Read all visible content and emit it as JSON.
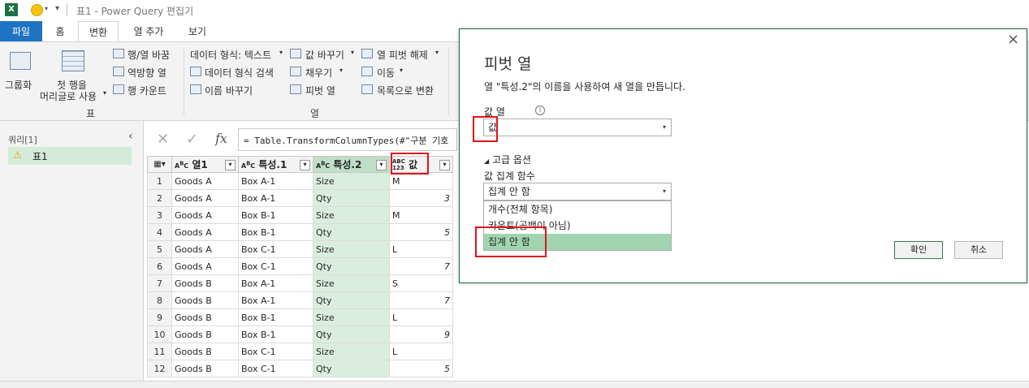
{
  "window": {
    "title": "표1 - Power Query 편집기",
    "app_icon": "excel-icon"
  },
  "ribbon": {
    "tabs": [
      "파일",
      "홈",
      "변환",
      "열 추가",
      "보기"
    ],
    "active_tab": "변환",
    "group_table": {
      "label": "표",
      "group_by": "그룹화",
      "first_row_line1": "첫 행을",
      "first_row_line2": "머리글로 사용",
      "transpose": "행/열 바꿈",
      "reverse_rows": "역방향 열",
      "count_rows": "행 카운트"
    },
    "group_column": {
      "label": "열",
      "data_type": "데이터 형식: 텍스트",
      "detect_type": "데이터 형식 검색",
      "rename": "이름 바꾸기",
      "replace_values": "값 바꾸기",
      "fill": "채우기",
      "pivot": "피벗 열",
      "unpivot": "열 피벗 해제",
      "move": "이동",
      "to_list": "목록으로 변환"
    }
  },
  "queries_pane": {
    "header": "쿼리[1]",
    "items": [
      "표1"
    ]
  },
  "formula": {
    "text": "= Table.TransformColumnTypes(#\"구분 기호"
  },
  "grid": {
    "columns": [
      {
        "type": "ABC",
        "name": "열1"
      },
      {
        "type": "ABC",
        "name": "특성.1"
      },
      {
        "type": "ABC",
        "name": "특성.2"
      },
      {
        "type": "ABC123",
        "name": "값"
      }
    ],
    "rows": [
      [
        "1",
        "Goods A",
        "Box A-1",
        "Size",
        "M"
      ],
      [
        "2",
        "Goods A",
        "Box A-1",
        "Qty",
        "3"
      ],
      [
        "3",
        "Goods A",
        "Box B-1",
        "Size",
        "M"
      ],
      [
        "4",
        "Goods A",
        "Box B-1",
        "Qty",
        "5"
      ],
      [
        "5",
        "Goods A",
        "Box C-1",
        "Size",
        "L"
      ],
      [
        "6",
        "Goods A",
        "Box C-1",
        "Qty",
        "7"
      ],
      [
        "7",
        "Goods B",
        "Box A-1",
        "Size",
        "S"
      ],
      [
        "8",
        "Goods B",
        "Box A-1",
        "Qty",
        "7"
      ],
      [
        "9",
        "Goods B",
        "Box B-1",
        "Size",
        "L"
      ],
      [
        "10",
        "Goods B",
        "Box B-1",
        "Qty",
        "9"
      ],
      [
        "11",
        "Goods B",
        "Box C-1",
        "Size",
        "L"
      ],
      [
        "12",
        "Goods B",
        "Box C-1",
        "Qty",
        "5"
      ]
    ]
  },
  "dialog": {
    "title": "피벗 열",
    "description": "열 \"특성.2\"의 이름을 사용하여 새 열을 만듭니다.",
    "values_label": "값 열",
    "values_value": "값",
    "advanced": "고급 옵션",
    "agg_label": "값 집계 함수",
    "agg_value": "집계 안 함",
    "agg_options": [
      "개수(전체 항목)",
      "카운트(공백이 아님)",
      "집계 안 함"
    ],
    "ok": "확인",
    "cancel": "취소",
    "close": "×"
  },
  "colors": {
    "file_tab": "#1f74c2",
    "highlight_red": "#e0141b",
    "selected_green": "#a1d5b0",
    "column_green": "#dbeedd"
  }
}
